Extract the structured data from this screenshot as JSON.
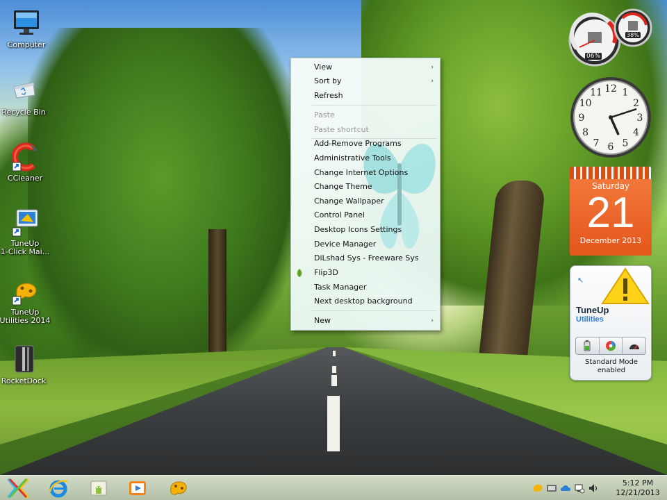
{
  "desktop": {
    "icons": [
      {
        "label": "Computer",
        "icon": "computer-icon"
      },
      {
        "label": "Recycle Bin",
        "icon": "recycle-bin-icon"
      },
      {
        "label": "CCleaner",
        "icon": "ccleaner-icon"
      },
      {
        "label_line1": "TuneUp",
        "label_line2": "1-Click Mai...",
        "icon": "tuneup-1click-icon"
      },
      {
        "label_line1": "TuneUp",
        "label_line2": "Utilities 2014",
        "icon": "tuneup-utilities-icon"
      },
      {
        "label": "RocketDock",
        "icon": "rocketdock-icon"
      }
    ]
  },
  "context_menu": {
    "items": [
      {
        "label": "View",
        "submenu": true
      },
      {
        "label": "Sort by",
        "submenu": true
      },
      {
        "label": "Refresh"
      },
      {
        "label": "Paste",
        "disabled": true
      },
      {
        "label": "Paste shortcut",
        "disabled": true
      },
      {
        "label": "Add-Remove Programs"
      },
      {
        "label": "Administrative Tools"
      },
      {
        "label": "Change Internet Options"
      },
      {
        "label": "Change Theme"
      },
      {
        "label": "Change Wallpaper"
      },
      {
        "label": "Control Panel"
      },
      {
        "label": "Desktop Icons Settings"
      },
      {
        "label": "Device Manager"
      },
      {
        "label": "DiLshad Sys - Freeware Sys"
      },
      {
        "label": "Flip3D",
        "icon": "leaf-icon"
      },
      {
        "label": "Task Manager"
      },
      {
        "label": "Next desktop background"
      },
      {
        "label": "New",
        "submenu": true
      }
    ],
    "submenu_arrow": "›"
  },
  "gadgets": {
    "cpu_meter": {
      "cpu_percent": "06%",
      "memory_percent": "38%"
    },
    "clock": {
      "numerals": [
        "12",
        "1",
        "2",
        "3",
        "4",
        "5",
        "6",
        "7",
        "8",
        "9",
        "10",
        "11"
      ],
      "hour": 5,
      "minute": 12
    },
    "calendar": {
      "weekday": "Saturday",
      "day": "21",
      "month_year": "December 2013"
    },
    "tuneup": {
      "title": "TuneUp",
      "subtitle": "Utilities",
      "status_line1": "Standard Mode",
      "status_line2": "enabled"
    }
  },
  "taskbar": {
    "buttons": [
      "start-icon",
      "internet-explorer-icon",
      "file-manager-icon",
      "media-player-icon",
      "tuneup-taskbar-icon"
    ],
    "tray_icons": [
      "tuneup-tray-icon",
      "vmware-tray-icon",
      "onedrive-tray-icon",
      "network-tray-icon",
      "volume-tray-icon"
    ],
    "time": "5:12 PM",
    "date": "12/21/2013"
  },
  "colors": {
    "calendar_orange": "#e4561c",
    "tuneup_blue": "#2b7fd4",
    "menu_disabled": "#9a9a9a"
  }
}
